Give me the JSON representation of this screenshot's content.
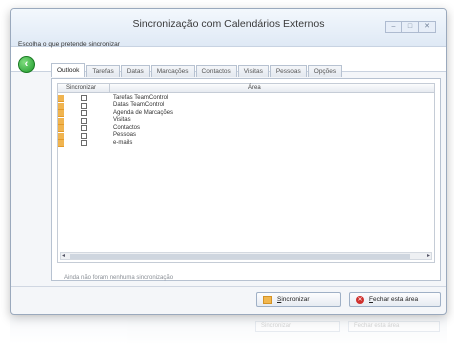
{
  "window": {
    "title": "Sincronização com Calendários Externos",
    "controls": {
      "minimize": "–",
      "maximize": "□",
      "close": "✕"
    }
  },
  "subtitle": "Escolha o que pretende sincronizar",
  "tabs": [
    {
      "label": "Outlook",
      "active": true
    },
    {
      "label": "Tarefas"
    },
    {
      "label": "Datas"
    },
    {
      "label": "Marcações"
    },
    {
      "label": "Contactos"
    },
    {
      "label": "Visitas"
    },
    {
      "label": "Pessoas"
    },
    {
      "label": "Opções"
    }
  ],
  "grid": {
    "headers": {
      "sync": "Sincronizar",
      "area": "Área"
    },
    "rows": [
      {
        "label": "Tarefas TeamControl",
        "checked": false
      },
      {
        "label": "Datas TeamControl",
        "checked": false
      },
      {
        "label": "Agenda de Marcações",
        "checked": false
      },
      {
        "label": "Visitas",
        "checked": false
      },
      {
        "label": "Contactos",
        "checked": false
      },
      {
        "label": "Pessoas",
        "checked": false
      },
      {
        "label": "e-mails",
        "checked": false
      }
    ]
  },
  "status_text": "Ainda não foram nenhuma sincronização",
  "buttons": {
    "sync": {
      "label": "Sincronizar",
      "accel": "S",
      "rest": "incronizar"
    },
    "close": {
      "label": "Fechar esta área",
      "accel": "F",
      "rest": "echar esta área"
    }
  },
  "colors": {
    "accent_green": "#1e9a2b",
    "row_marker": "#f0b450",
    "close_icon": "#d0302d"
  }
}
